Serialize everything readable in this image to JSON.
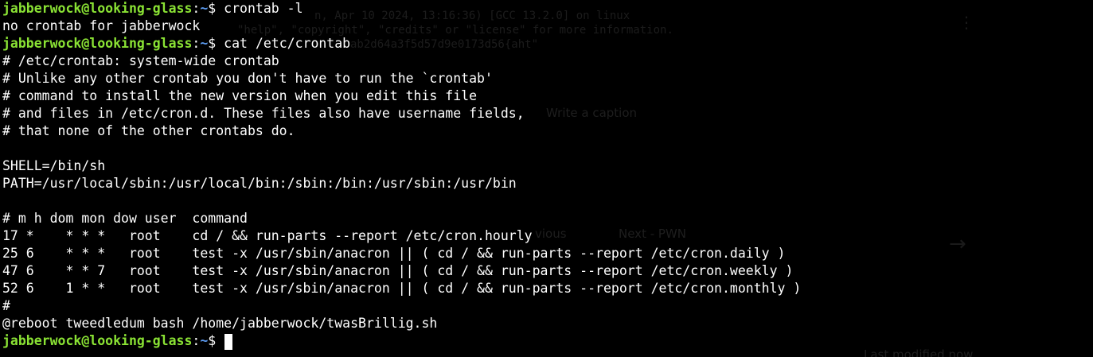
{
  "colors": {
    "background": "#000000",
    "text": "#ffffff",
    "prompt_user": "#8ae234",
    "prompt_path": "#5c9bf0"
  },
  "prompt": {
    "user_host": "jabberwock@looking-glass",
    "separator": ":",
    "path": "~",
    "symbol": "$ "
  },
  "lines": [
    {
      "type": "prompt",
      "command": "crontab -l"
    },
    {
      "type": "output",
      "text": "no crontab for jabberwock"
    },
    {
      "type": "prompt",
      "command": "cat /etc/crontab"
    },
    {
      "type": "output",
      "text": "# /etc/crontab: system-wide crontab"
    },
    {
      "type": "output",
      "text": "# Unlike any other crontab you don't have to run the `crontab'"
    },
    {
      "type": "output",
      "text": "# command to install the new version when you edit this file"
    },
    {
      "type": "output",
      "text": "# and files in /etc/cron.d. These files also have username fields,"
    },
    {
      "type": "output",
      "text": "# that none of the other crontabs do."
    },
    {
      "type": "output",
      "text": ""
    },
    {
      "type": "output",
      "text": "SHELL=/bin/sh"
    },
    {
      "type": "output",
      "text": "PATH=/usr/local/sbin:/usr/local/bin:/sbin:/bin:/usr/sbin:/usr/bin"
    },
    {
      "type": "output",
      "text": ""
    },
    {
      "type": "output",
      "text": "# m h dom mon dow user  command"
    },
    {
      "type": "output",
      "text": "17 *    * * *   root    cd / && run-parts --report /etc/cron.hourly"
    },
    {
      "type": "output",
      "text": "25 6    * * *   root    test -x /usr/sbin/anacron || ( cd / && run-parts --report /etc/cron.daily )"
    },
    {
      "type": "output",
      "text": "47 6    * * 7   root    test -x /usr/sbin/anacron || ( cd / && run-parts --report /etc/cron.weekly )"
    },
    {
      "type": "output",
      "text": "52 6    1 * *   root    test -x /usr/sbin/anacron || ( cd / && run-parts --report /etc/cron.monthly )"
    },
    {
      "type": "output",
      "text": "#"
    },
    {
      "type": "output",
      "text": "@reboot tweedledum bash /home/jabberwock/twasBrillig.sh"
    },
    {
      "type": "prompt",
      "command": "",
      "cursor": true
    }
  ],
  "ghost": {
    "line1": "n, Apr 10 2024, 13:16:36) [GCC 13.2.0] on linux",
    "line2": "\"help\", \"copyright\", \"credits\" or \"license\" for more information.",
    "line3": "ab2d64a3f5d57d9e0173d56{aht\"",
    "caption": "Write a caption",
    "previous": "vious",
    "next": "Next - PWN",
    "modified": "Last modified now"
  }
}
